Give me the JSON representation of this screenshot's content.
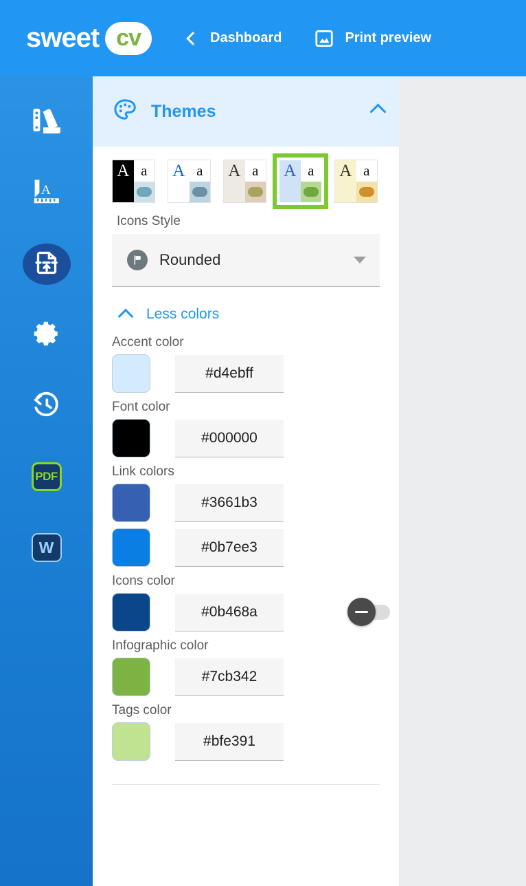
{
  "header": {
    "logo_text": "sweet",
    "logo_pill_text": "cv",
    "back_icon": "chevron-left-icon",
    "dashboard_label": "Dashboard",
    "print_icon": "image-icon",
    "print_preview_label": "Print preview",
    "background_color": "#2196f3"
  },
  "sidebar": {
    "background_gradient": [
      "#2b92e4",
      "#1573c8"
    ],
    "items": [
      {
        "icon": "palette-swatches-icon",
        "active": false
      },
      {
        "icon": "typography-ruler-icon",
        "active": false
      },
      {
        "icon": "file-upload-icon",
        "active": true
      },
      {
        "icon": "gear-icon",
        "active": false
      },
      {
        "icon": "history-clock-icon",
        "active": false
      },
      {
        "icon": "pdf-export-icon",
        "label": "PDF",
        "active": false
      },
      {
        "icon": "word-export-icon",
        "label": "W",
        "active": false
      }
    ]
  },
  "panel": {
    "header": {
      "icon": "palette-icon",
      "title": "Themes",
      "collapse_icon": "chevron-up-icon",
      "background_color": "#e3f0fd",
      "title_color": "#2196f3"
    },
    "themes": [
      {
        "name": "theme-black",
        "selected": false,
        "quad_top_left_bg": "#000000",
        "quad_top_left_letter": "A",
        "quad_top_left_letter_color": "#ffffff",
        "quad_top_right_bg": "#ffffff",
        "quad_top_right_letter": "a",
        "quad_bottom_left_bg": "#000000",
        "quad_bottom_right_bg": "#cfe0e6",
        "dot_color": "#6fa8bd"
      },
      {
        "name": "theme-white-blue",
        "selected": false,
        "quad_top_left_bg": "#ffffff",
        "quad_top_left_letter": "A",
        "quad_top_left_letter_color": "#1565c0",
        "quad_top_right_bg": "#ffffff",
        "quad_top_right_letter": "a",
        "quad_bottom_left_bg": "#ffffff",
        "quad_bottom_right_bg": "#bcd5e0",
        "dot_color": "#6c91a6"
      },
      {
        "name": "theme-beige",
        "selected": false,
        "quad_top_left_bg": "#edeae4",
        "quad_top_left_letter": "A",
        "quad_top_left_letter_color": "#3b3128",
        "quad_top_right_bg": "#ffffff",
        "quad_top_right_letter": "a",
        "quad_bottom_left_bg": "#edeae4",
        "quad_bottom_right_bg": "#e0cdbb",
        "dot_color": "#a8a35e"
      },
      {
        "name": "theme-blue-green",
        "selected": true,
        "quad_top_left_bg": "#cfe2f8",
        "quad_top_left_letter": "A",
        "quad_top_left_letter_color": "#2f5cb3",
        "quad_top_right_bg": "#ffffff",
        "quad_top_right_letter": "a",
        "quad_bottom_left_bg": "#cfe2f8",
        "quad_bottom_right_bg": "#b5d98e",
        "dot_color": "#6fa840",
        "selection_color": "#7cc932"
      },
      {
        "name": "theme-cream",
        "selected": false,
        "quad_top_left_bg": "#f8f3cf",
        "quad_top_left_letter": "A",
        "quad_top_left_letter_color": "#3b3128",
        "quad_top_right_bg": "#ffffff",
        "quad_top_right_letter": "a",
        "quad_bottom_left_bg": "#f8f3cf",
        "quad_bottom_right_bg": "#f2e2a8",
        "dot_color": "#d08f2a"
      }
    ],
    "icons_style": {
      "label": "Icons Style",
      "icon": "flag-circle-icon",
      "value": "Rounded",
      "caret": "caret-down-icon"
    },
    "less_colors": {
      "chevron": "chevron-up-icon",
      "label": "Less colors"
    },
    "colors": [
      {
        "group_label": "Accent color",
        "rows": [
          {
            "name": "accent-color",
            "swatch": "#d4ebff",
            "hex": "#d4ebff",
            "toggle": null
          }
        ]
      },
      {
        "group_label": "Font color",
        "rows": [
          {
            "name": "font-color",
            "swatch": "#000000",
            "hex": "#000000",
            "toggle": null
          }
        ]
      },
      {
        "group_label": "Link colors",
        "rows": [
          {
            "name": "link-color-primary",
            "swatch": "#3661b3",
            "hex": "#3661b3",
            "toggle": null
          },
          {
            "name": "link-color-secondary",
            "swatch": "#0b7ee3",
            "hex": "#0b7ee3",
            "toggle": null
          }
        ]
      },
      {
        "group_label": "Icons color",
        "rows": [
          {
            "name": "icons-color",
            "swatch": "#0b468a",
            "hex": "#0b468a",
            "toggle": "off"
          }
        ]
      },
      {
        "group_label": "Infographic color",
        "rows": [
          {
            "name": "infographic-color",
            "swatch": "#7cb342",
            "hex": "#7cb342",
            "toggle": null
          }
        ]
      },
      {
        "group_label": "Tags color",
        "rows": [
          {
            "name": "tags-color",
            "swatch": "#bfe391",
            "hex": "#bfe391",
            "toggle": null
          }
        ]
      }
    ]
  },
  "canvas": {
    "background_color": "#ebedee"
  }
}
